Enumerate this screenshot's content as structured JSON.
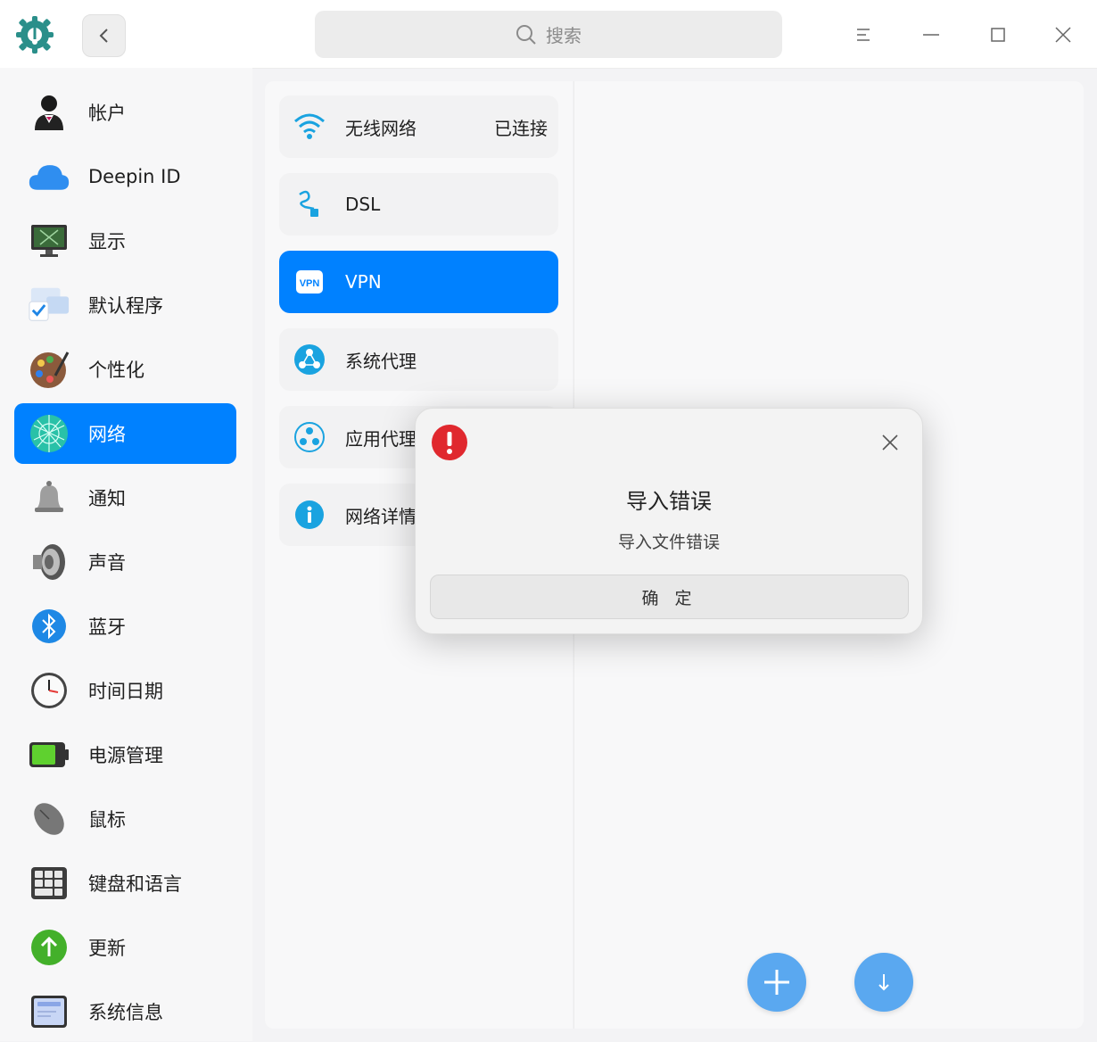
{
  "search": {
    "placeholder": "搜索"
  },
  "sidebar": {
    "items": [
      {
        "label": "帐户",
        "icon": "account-icon"
      },
      {
        "label": "Deepin ID",
        "icon": "cloud-icon"
      },
      {
        "label": "显示",
        "icon": "display-icon"
      },
      {
        "label": "默认程序",
        "icon": "default-apps-icon"
      },
      {
        "label": "个性化",
        "icon": "personalization-icon"
      },
      {
        "label": "网络",
        "icon": "network-icon",
        "active": true
      },
      {
        "label": "通知",
        "icon": "bell-icon"
      },
      {
        "label": "声音",
        "icon": "speaker-icon"
      },
      {
        "label": "蓝牙",
        "icon": "bluetooth-icon"
      },
      {
        "label": "时间日期",
        "icon": "clock-icon"
      },
      {
        "label": "电源管理",
        "icon": "battery-icon"
      },
      {
        "label": "鼠标",
        "icon": "mouse-icon"
      },
      {
        "label": "键盘和语言",
        "icon": "keyboard-icon"
      },
      {
        "label": "更新",
        "icon": "update-icon"
      },
      {
        "label": "系统信息",
        "icon": "system-info-icon"
      }
    ]
  },
  "network": {
    "items": [
      {
        "label": "无线网络",
        "status": "已连接",
        "icon": "wifi-icon"
      },
      {
        "label": "DSL",
        "icon": "dsl-icon"
      },
      {
        "label": "VPN",
        "icon": "vpn-icon",
        "active": true
      },
      {
        "label": "系统代理",
        "icon": "proxy-icon"
      },
      {
        "label": "应用代理",
        "icon": "app-proxy-icon"
      },
      {
        "label": "网络详情",
        "icon": "info-icon"
      }
    ]
  },
  "icons": {
    "vpn_badge": "VPN"
  },
  "dialog": {
    "title": "导入错误",
    "message": "导入文件错误",
    "confirm": "确 定"
  },
  "colors": {
    "accent": "#0081ff",
    "fab": "#5aa8f0",
    "error": "#e0282e"
  }
}
